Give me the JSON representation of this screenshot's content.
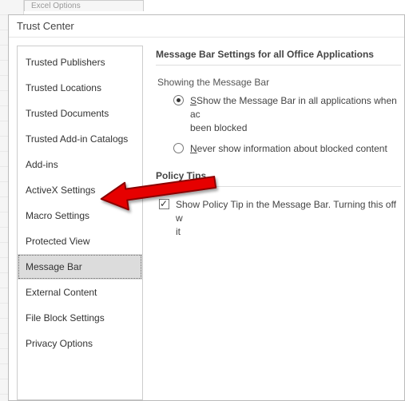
{
  "bg_tab_label": "Excel Options",
  "window": {
    "title": "Trust Center"
  },
  "sidebar": {
    "items": [
      {
        "label": "Trusted Publishers",
        "selected": false
      },
      {
        "label": "Trusted Locations",
        "selected": false
      },
      {
        "label": "Trusted Documents",
        "selected": false
      },
      {
        "label": "Trusted Add-in Catalogs",
        "selected": false
      },
      {
        "label": "Add-ins",
        "selected": false
      },
      {
        "label": "ActiveX Settings",
        "selected": false
      },
      {
        "label": "Macro Settings",
        "selected": false
      },
      {
        "label": "Protected View",
        "selected": false
      },
      {
        "label": "Message Bar",
        "selected": true
      },
      {
        "label": "External Content",
        "selected": false
      },
      {
        "label": "File Block Settings",
        "selected": false
      },
      {
        "label": "Privacy Options",
        "selected": false
      }
    ]
  },
  "content": {
    "section1_title": "Message Bar Settings for all Office Applications",
    "subheading": "Showing the Message Bar",
    "radio1": {
      "prefix": "Show the Message Bar in all applications when ac",
      "suffix": " been blocked",
      "checked": true,
      "underline_char": "S"
    },
    "radio2": {
      "text": "ever show information about blocked content",
      "checked": false,
      "underline_char": "N"
    },
    "section2_title": "Policy Tips",
    "check1": {
      "text": "Show Policy Tip in the Message Bar. Turning this off w",
      "suffix": "it",
      "checked": true
    }
  },
  "arrow": {
    "color": "#e60000",
    "target": "Macro Settings"
  }
}
